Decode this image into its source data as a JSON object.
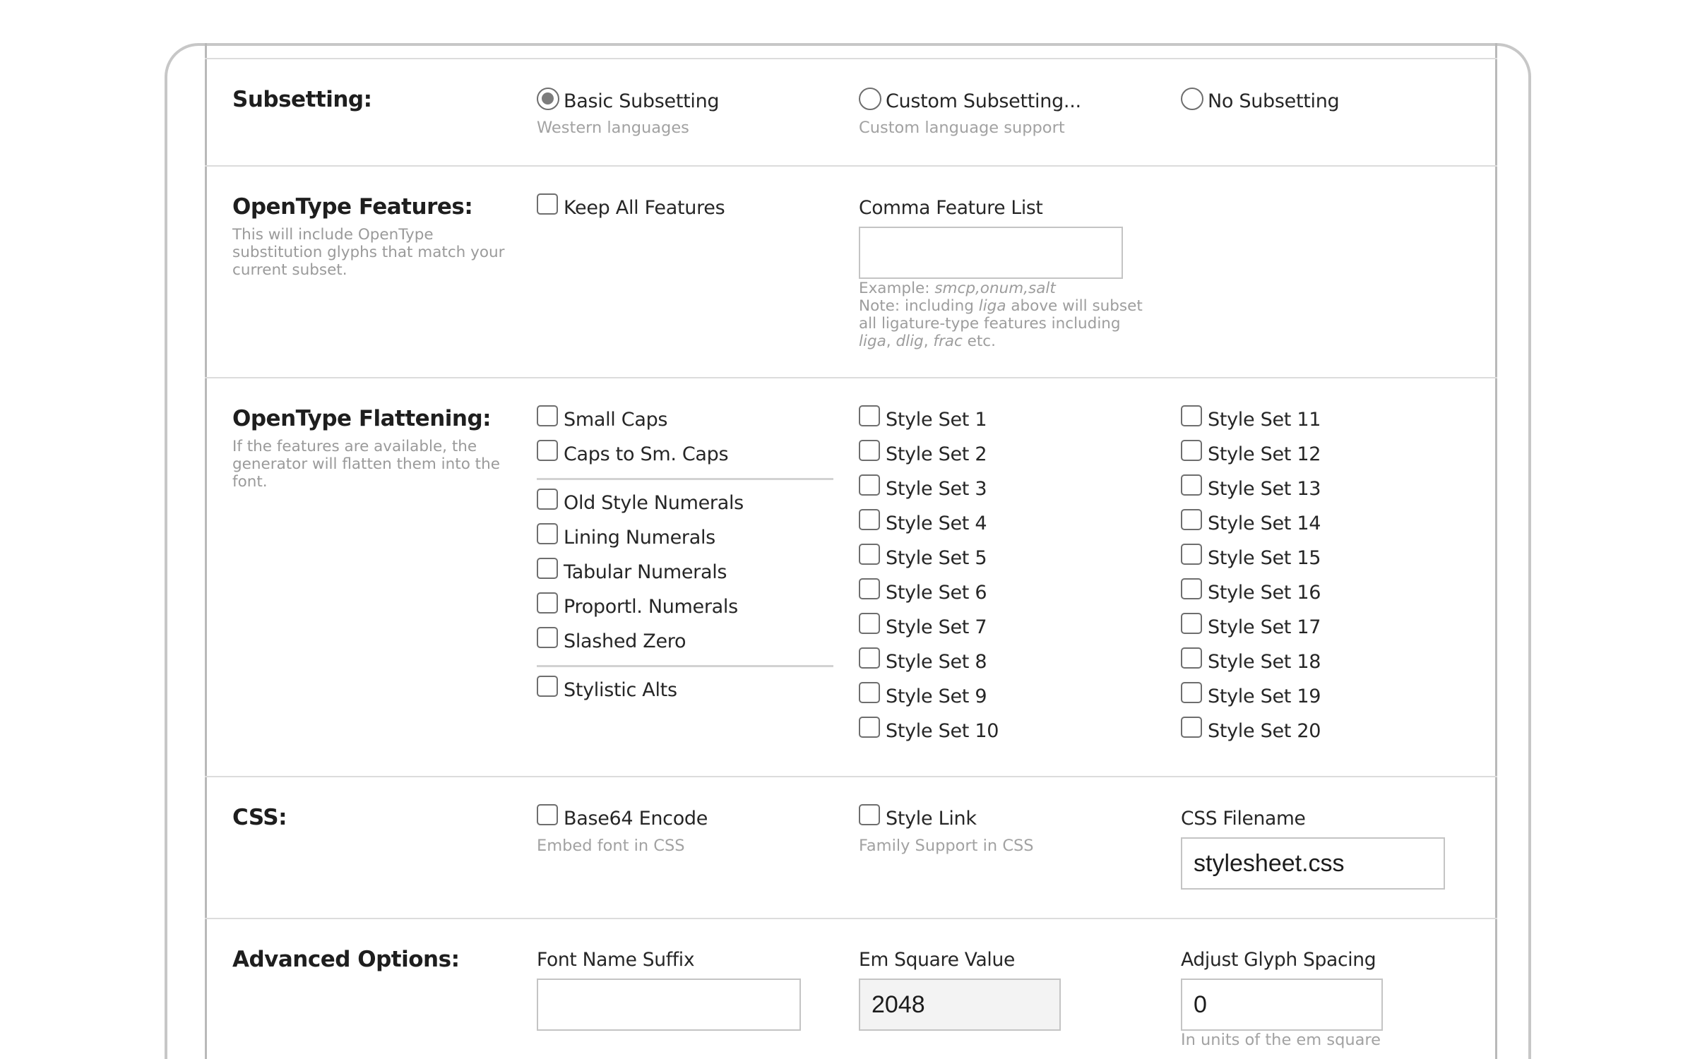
{
  "subsetting": {
    "heading": "Subsetting:",
    "options": [
      {
        "label": "Basic Subsetting",
        "sub": "Western languages",
        "selected": true
      },
      {
        "label": "Custom Subsetting...",
        "sub": "Custom language support",
        "selected": false
      },
      {
        "label": "No Subsetting",
        "sub": "",
        "selected": false
      }
    ]
  },
  "opentype_features": {
    "heading": "OpenType Features:",
    "description": "This will include OpenType substitution glyphs that match your current subset.",
    "keep_all_label": "Keep All Features",
    "keep_all_checked": false,
    "feature_list_label": "Comma Feature List",
    "feature_list_value": "",
    "example_prefix": "Example: ",
    "example_value": "smcp,onum,salt",
    "note_1": "Note: including ",
    "note_liga": "liga",
    "note_2": " above will subset all ligature-type features including ",
    "note_liga2": "liga",
    "note_sep1": ", ",
    "note_dlig": "dlig",
    "note_sep2": ", ",
    "note_frac": "frac",
    "note_end": " etc."
  },
  "opentype_flattening": {
    "heading": "OpenType Flattening:",
    "description": "If the features are available, the generator will flatten them into the font.",
    "col1_group1": [
      "Small Caps",
      "Caps to Sm. Caps"
    ],
    "col1_group2": [
      "Old Style Numerals",
      "Lining Numerals",
      "Tabular Numerals",
      "Proportl. Numerals",
      "Slashed Zero"
    ],
    "col1_group3": [
      "Stylistic Alts"
    ],
    "col2": [
      "Style Set 1",
      "Style Set 2",
      "Style Set 3",
      "Style Set 4",
      "Style Set 5",
      "Style Set 6",
      "Style Set 7",
      "Style Set 8",
      "Style Set 9",
      "Style Set 10"
    ],
    "col3": [
      "Style Set 11",
      "Style Set 12",
      "Style Set 13",
      "Style Set 14",
      "Style Set 15",
      "Style Set 16",
      "Style Set 17",
      "Style Set 18",
      "Style Set 19",
      "Style Set 20"
    ]
  },
  "css": {
    "heading": "CSS:",
    "base64_label": "Base64 Encode",
    "base64_sub": "Embed font in CSS",
    "style_link_label": "Style Link",
    "style_link_sub": "Family Support in CSS",
    "filename_label": "CSS Filename",
    "filename_value": "stylesheet.css"
  },
  "advanced": {
    "heading": "Advanced Options:",
    "font_suffix_label": "Font Name Suffix",
    "font_suffix_value": "",
    "em_square_label": "Em Square Value",
    "em_square_value": "2048",
    "glyph_spacing_label": "Adjust Glyph Spacing",
    "glyph_spacing_value": "0",
    "glyph_spacing_sub": "In units of the em square"
  }
}
